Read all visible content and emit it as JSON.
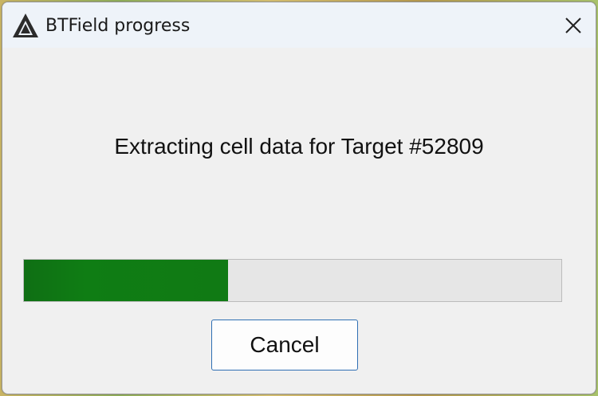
{
  "window": {
    "title": "BTField progress",
    "icon": "btfield-logo-icon",
    "close_icon": "close-icon"
  },
  "dialog": {
    "message": "Extracting cell data for Target #52809",
    "progress_fraction": 0.38,
    "progress_color": "#0f7d14",
    "cancel_label": "Cancel"
  }
}
